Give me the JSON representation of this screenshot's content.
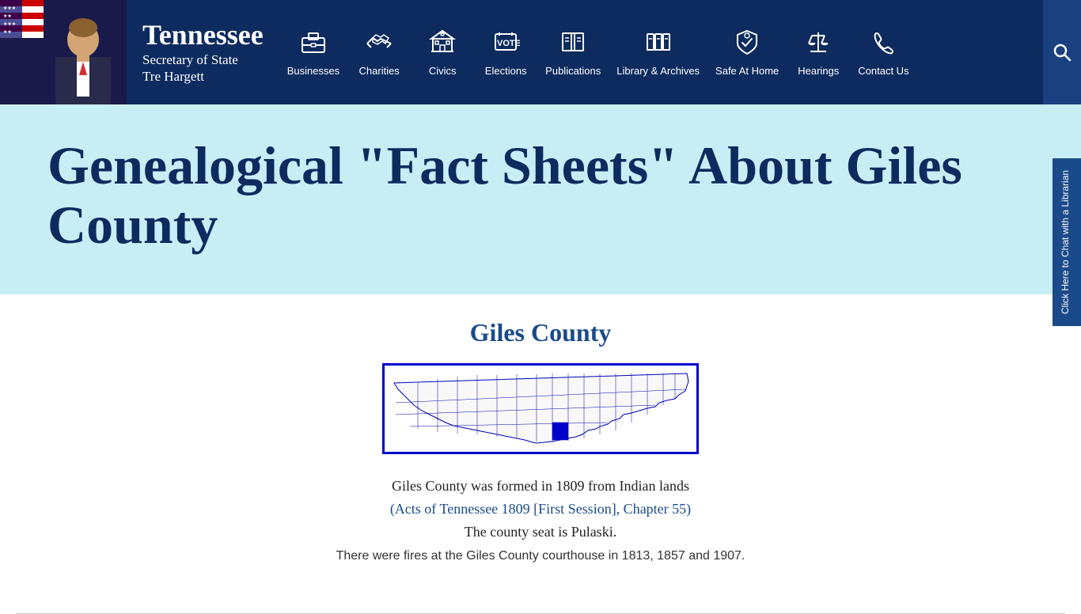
{
  "header": {
    "state": "Tennessee",
    "office": "Secretary of State",
    "name": "Tre Hargett"
  },
  "nav": {
    "items": [
      {
        "id": "businesses",
        "label": "Businesses",
        "icon": "briefcase"
      },
      {
        "id": "charities",
        "label": "Charities",
        "icon": "handshake"
      },
      {
        "id": "civics",
        "label": "Civics",
        "icon": "building"
      },
      {
        "id": "elections",
        "label": "Elections",
        "icon": "vote"
      },
      {
        "id": "publications",
        "label": "Publications",
        "icon": "book"
      },
      {
        "id": "library",
        "label": "Library & Archives",
        "icon": "archive"
      },
      {
        "id": "safehome",
        "label": "Safe At Home",
        "icon": "shield"
      },
      {
        "id": "hearings",
        "label": "Hearings",
        "icon": "scale"
      },
      {
        "id": "contact",
        "label": "Contact Us",
        "icon": "phone"
      }
    ]
  },
  "hero": {
    "title": "Genealogical \"Fact Sheets\" About Giles County"
  },
  "content": {
    "county_name": "Giles County",
    "formation_text": "Giles County was formed in 1809 from Indian lands",
    "acts_link": "(Acts of Tennessee 1809 [First Session], Chapter 55)",
    "seat_text": "The county seat is Pulaski.",
    "fires_text": "There were fires at the Giles County courthouse in 1813, 1857 and 1907."
  },
  "chat_sidebar": {
    "label": "Click Here to Chat with a Librarian"
  }
}
